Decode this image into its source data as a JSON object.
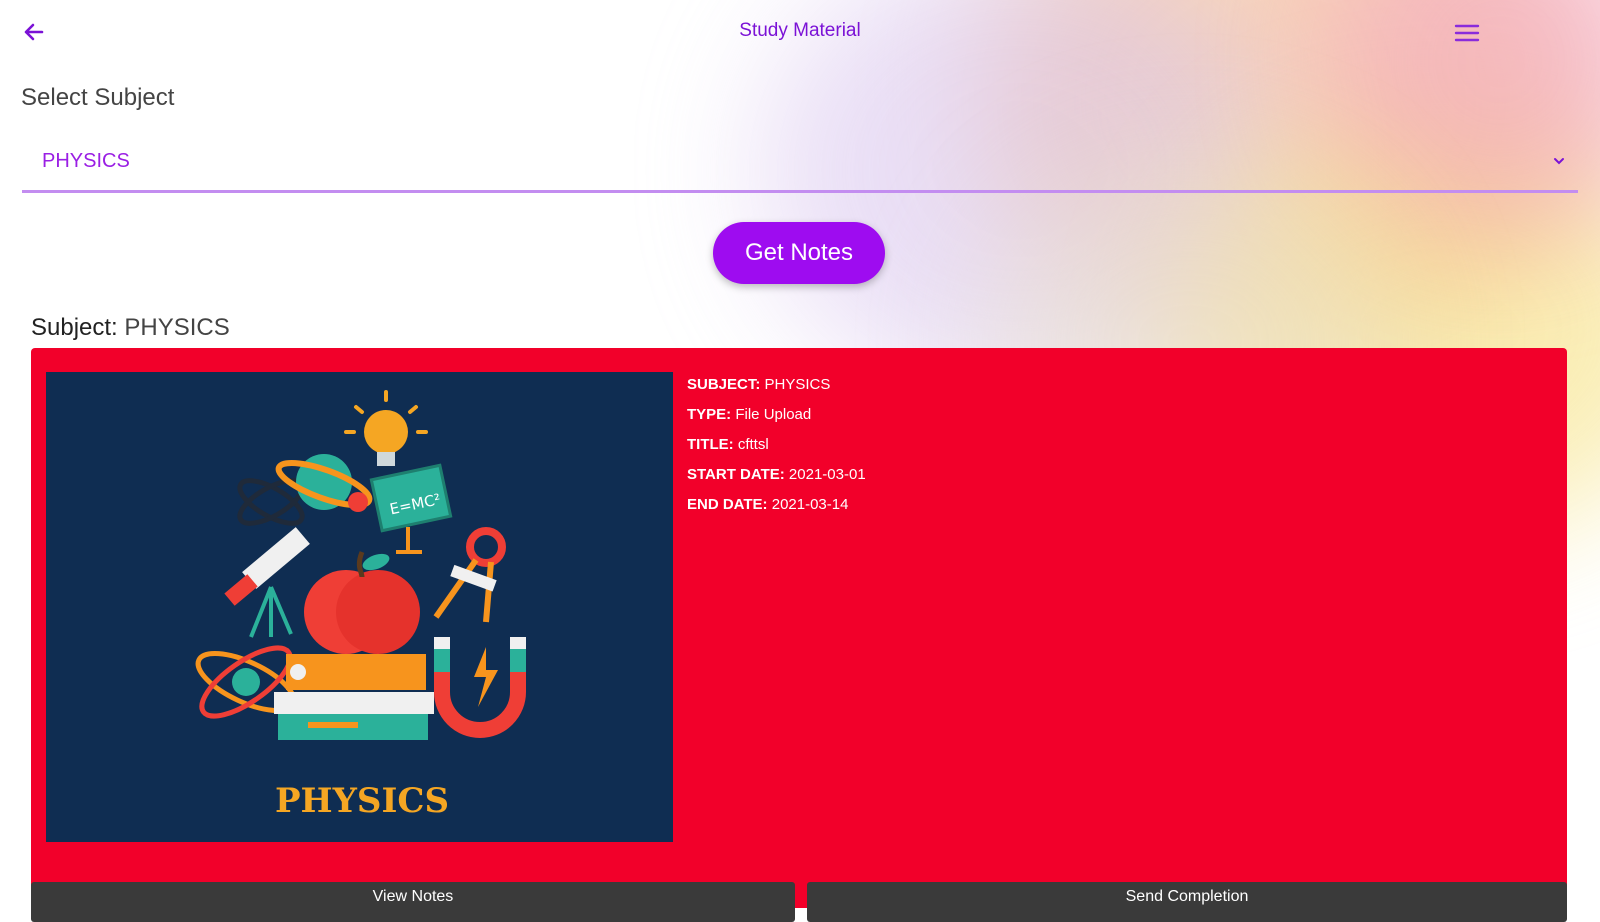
{
  "header": {
    "title": "Study Material",
    "back_icon": "arrow-left-icon",
    "menu_icon": "hamburger-menu-icon",
    "accent_color": "#7b12d6"
  },
  "form": {
    "label": "Select Subject",
    "selected": "PHYSICS",
    "chevron_icon": "chevron-down-icon",
    "button_label": "Get Notes",
    "button_color": "#9e0cf0"
  },
  "result": {
    "heading_prefix": "Subject: ",
    "heading_value": "PHYSICS"
  },
  "card": {
    "color": "#f2002a",
    "image_caption": "PHYSICS",
    "image_formula": "E=MC²",
    "details": [
      {
        "key": "SUBJECT:",
        "value": " PHYSICS"
      },
      {
        "key": "TYPE:",
        "value": " File Upload"
      },
      {
        "key": "TITLE:",
        "value": " cfttsl"
      },
      {
        "key": "START DATE:",
        "value": " 2021-03-01"
      },
      {
        "key": "END DATE:",
        "value": " 2021-03-14"
      }
    ],
    "actions": [
      "View Notes",
      "Send Completion"
    ]
  }
}
